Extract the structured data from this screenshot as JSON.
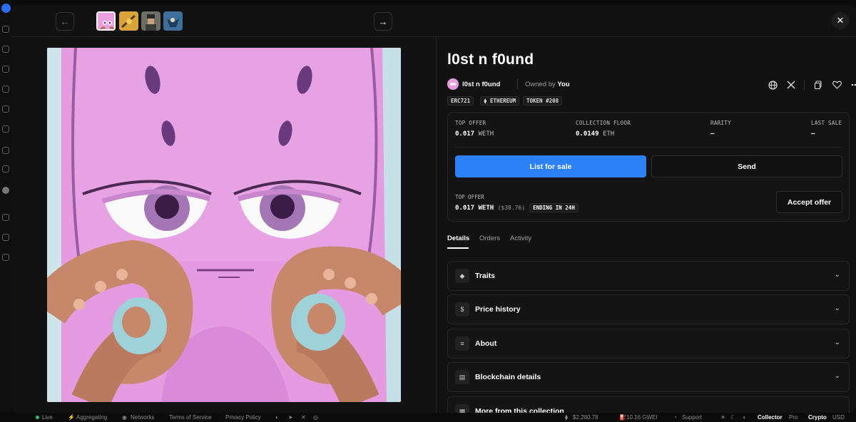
{
  "modal": {
    "prev_arrow": "←",
    "next_arrow": "→",
    "close_glyph": "✕"
  },
  "nft": {
    "title": "l0st n f0und",
    "collection_name": "l0st n f0und",
    "owned_prefix": "Owned by",
    "owner": "You",
    "tags": [
      "ERC721",
      "⧫ ETHEREUM",
      "TOKEN #208"
    ]
  },
  "stats": [
    {
      "label": "TOP OFFER",
      "value": "0.017",
      "unit": "WETH"
    },
    {
      "label": "COLLECTION FLOOR",
      "value": "0.0149",
      "unit": "ETH"
    },
    {
      "label": "RARITY",
      "value": "–",
      "unit": ""
    },
    {
      "label": "LAST SALE",
      "value": "–",
      "unit": ""
    }
  ],
  "actions": {
    "list_label": "List for sale",
    "send_label": "Send",
    "accept_label": "Accept offer"
  },
  "top_offer": {
    "label": "TOP OFFER",
    "amount": "0.017 WETH",
    "usd": "($38.76)",
    "ending": "ENDING IN 24H"
  },
  "tabs": [
    "Details",
    "Orders",
    "Activity"
  ],
  "sections": [
    {
      "title": "Traits",
      "icon": "◆"
    },
    {
      "title": "Price history",
      "icon": "$"
    },
    {
      "title": "About",
      "icon": "≡"
    },
    {
      "title": "Blockchain details",
      "icon": "▤"
    },
    {
      "title": "More from this collection",
      "icon": "▦"
    }
  ],
  "status_bar": {
    "live": "Live",
    "aggregating": "Aggregating",
    "networks": "Networks",
    "terms": "Terms of Service",
    "privacy": "Privacy Policy",
    "eth_price": "$2,280.78",
    "gas": "10.16 GWEI",
    "support": "Support",
    "collector": "Collector",
    "pro": "Pro",
    "crypto": "Crypto",
    "currency": "USD"
  },
  "colors": {
    "accent_blue": "#2d81f7",
    "artwork_pink": "#e49ad9",
    "live_green": "#2fbf71"
  }
}
